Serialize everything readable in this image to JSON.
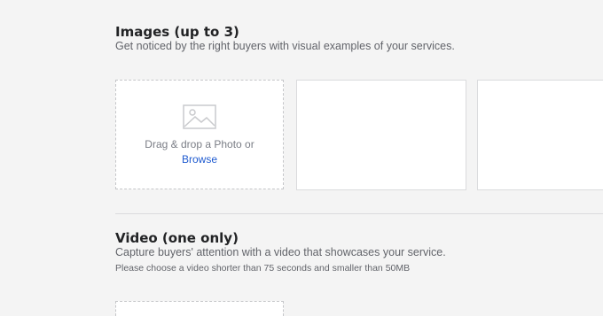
{
  "images": {
    "title": "Images (up to 3)",
    "subtitle": "Get noticed by the right buyers with visual examples of your services.",
    "dropzone": {
      "icon": "image-icon",
      "text": "Drag & drop a Photo or",
      "browse_label": "Browse"
    }
  },
  "video": {
    "title": "Video (one only)",
    "subtitle": "Capture buyers' attention with a video that showcases your service.",
    "note": "Please choose a video shorter than 75 seconds and smaller than 50MB"
  },
  "colors": {
    "background": "#f4f4f4",
    "link": "#1f5bd0",
    "text": "#222325",
    "muted": "#62646a"
  }
}
